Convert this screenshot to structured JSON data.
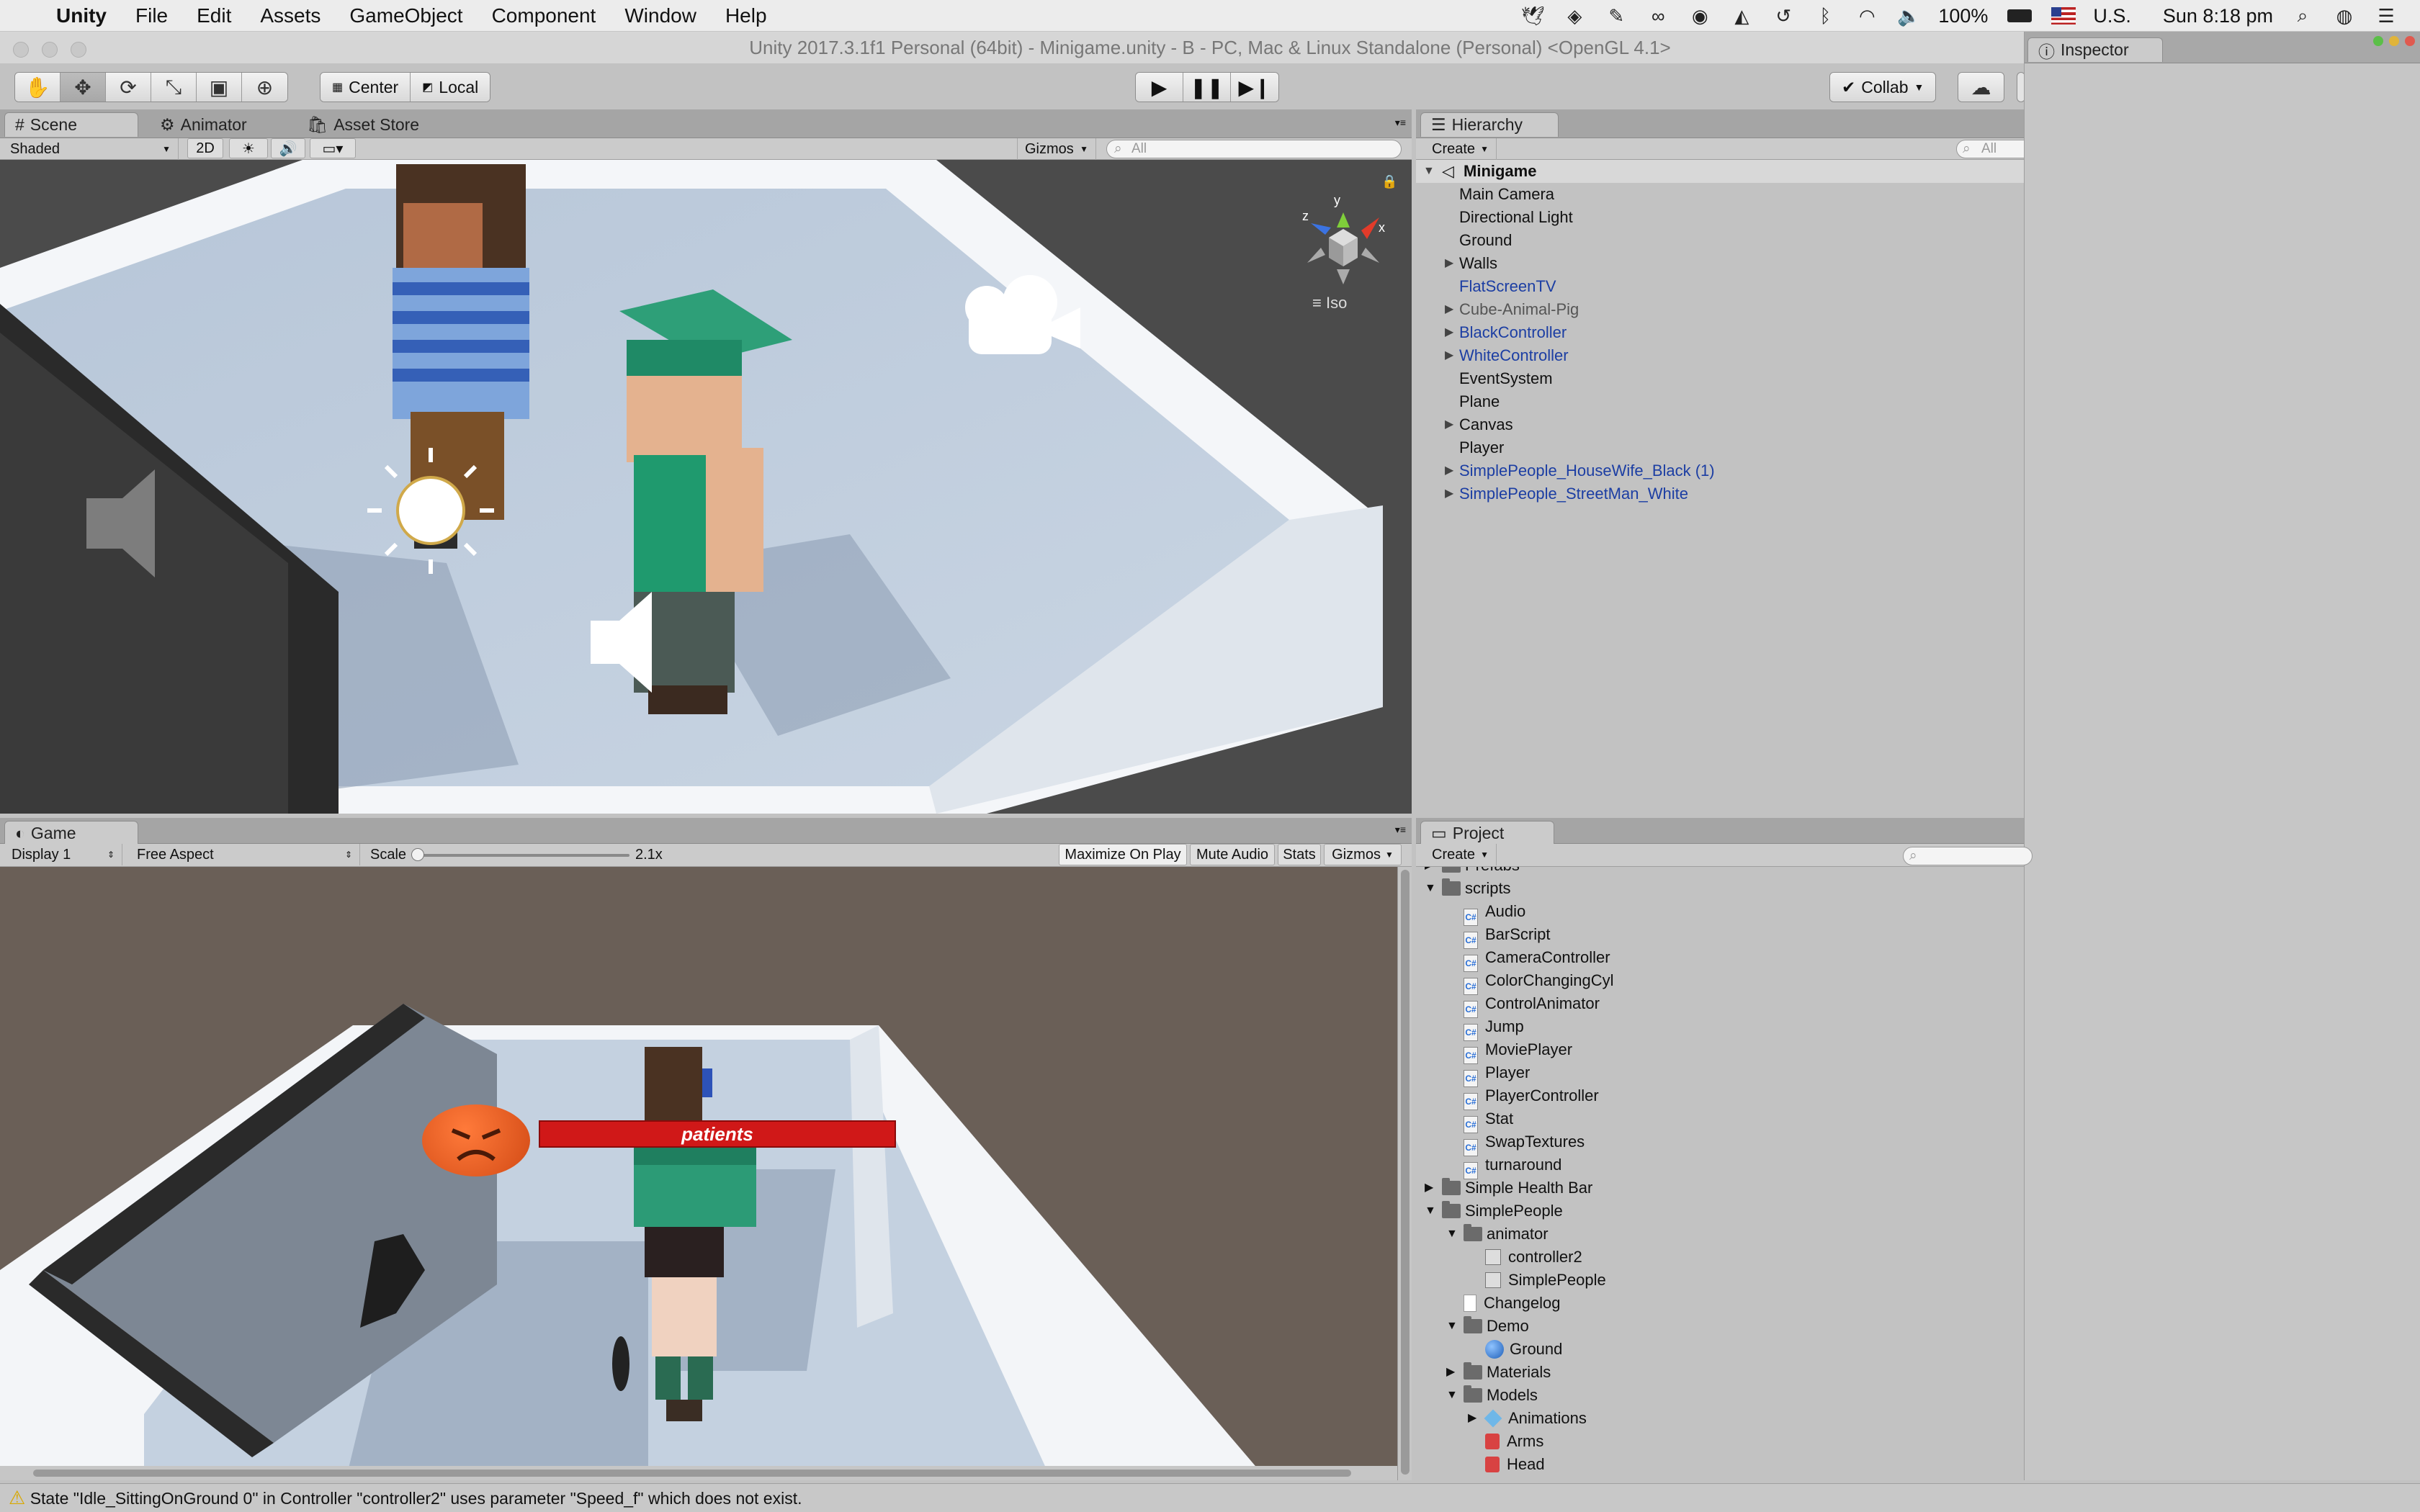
{
  "menubar": {
    "items": [
      "Unity",
      "File",
      "Edit",
      "Assets",
      "GameObject",
      "Component",
      "Window",
      "Help"
    ],
    "status": {
      "battery": "100%",
      "input_source": "U.S.",
      "clock": "Sun 8:18 pm"
    }
  },
  "window": {
    "title": "Unity 2017.3.1f1 Personal (64bit) - Minigame.unity - B - PC, Mac & Linux Standalone (Personal) <OpenGL 4.1>"
  },
  "toolbar": {
    "pivot_center": "Center",
    "pivot_local": "Local",
    "collab": "Collab"
  },
  "scene": {
    "tabs": [
      "Scene",
      "Animator",
      "Asset Store"
    ],
    "shading_mode": "Shaded",
    "mode_2d": "2D",
    "gizmos": "Gizmos",
    "search_placeholder": "All",
    "view_mode": "Iso",
    "axis_labels": {
      "x": "x",
      "y": "y",
      "z": "z"
    }
  },
  "game": {
    "tab": "Game",
    "display": "Display 1",
    "aspect": "Free Aspect",
    "scale_label": "Scale",
    "scale_value": "2.1x",
    "scale_fraction": 0.02,
    "buttons": [
      "Maximize On Play",
      "Mute Audio",
      "Stats",
      "Gizmos"
    ],
    "health_bar_label": "patients"
  },
  "hierarchy": {
    "tab": "Hierarchy",
    "create": "Create",
    "search_placeholder": "All",
    "scene_name": "Minigame",
    "items": [
      {
        "label": "Main Camera",
        "expandable": false,
        "style": "normal"
      },
      {
        "label": "Directional Light",
        "expandable": false,
        "style": "normal"
      },
      {
        "label": "Ground",
        "expandable": false,
        "style": "normal"
      },
      {
        "label": "Walls",
        "expandable": true,
        "style": "normal"
      },
      {
        "label": "FlatScreenTV",
        "expandable": false,
        "style": "prefab"
      },
      {
        "label": "Cube-Animal-Pig",
        "expandable": true,
        "style": "disabled"
      },
      {
        "label": "BlackController",
        "expandable": true,
        "style": "prefab"
      },
      {
        "label": "WhiteController",
        "expandable": true,
        "style": "prefab"
      },
      {
        "label": "EventSystem",
        "expandable": false,
        "style": "normal"
      },
      {
        "label": "Plane",
        "expandable": false,
        "style": "normal"
      },
      {
        "label": "Canvas",
        "expandable": true,
        "style": "normal"
      },
      {
        "label": "Player",
        "expandable": false,
        "style": "normal"
      },
      {
        "label": "SimplePeople_HouseWife_Black (1)",
        "expandable": true,
        "style": "prefab"
      },
      {
        "label": "SimplePeople_StreetMan_White",
        "expandable": true,
        "style": "prefab"
      }
    ]
  },
  "inspector": {
    "tab": "Inspector"
  },
  "project": {
    "tab": "Project",
    "create": "Create",
    "items": [
      {
        "label": "Prefabs",
        "indent": 0,
        "arrow": "right",
        "icon": "folder"
      },
      {
        "label": "scripts",
        "indent": 0,
        "arrow": "down",
        "icon": "folder"
      },
      {
        "label": "Audio",
        "indent": 1,
        "arrow": "",
        "icon": "script"
      },
      {
        "label": "BarScript",
        "indent": 1,
        "arrow": "",
        "icon": "script"
      },
      {
        "label": "CameraController",
        "indent": 1,
        "arrow": "",
        "icon": "script"
      },
      {
        "label": "ColorChangingCyl",
        "indent": 1,
        "arrow": "",
        "icon": "script"
      },
      {
        "label": "ControlAnimator",
        "indent": 1,
        "arrow": "",
        "icon": "script"
      },
      {
        "label": "Jump",
        "indent": 1,
        "arrow": "",
        "icon": "script"
      },
      {
        "label": "MoviePlayer",
        "indent": 1,
        "arrow": "",
        "icon": "script"
      },
      {
        "label": "Player",
        "indent": 1,
        "arrow": "",
        "icon": "script"
      },
      {
        "label": "PlayerController",
        "indent": 1,
        "arrow": "",
        "icon": "script"
      },
      {
        "label": "Stat",
        "indent": 1,
        "arrow": "",
        "icon": "script"
      },
      {
        "label": "SwapTextures",
        "indent": 1,
        "arrow": "",
        "icon": "script"
      },
      {
        "label": "turnaround",
        "indent": 1,
        "arrow": "",
        "icon": "script"
      },
      {
        "label": "Simple Health Bar",
        "indent": 0,
        "arrow": "right",
        "icon": "folder"
      },
      {
        "label": "SimplePeople",
        "indent": 0,
        "arrow": "down",
        "icon": "folder"
      },
      {
        "label": "animator",
        "indent": 1,
        "arrow": "down",
        "icon": "folder"
      },
      {
        "label": "controller2",
        "indent": 2,
        "arrow": "",
        "icon": "controller"
      },
      {
        "label": "SimplePeople",
        "indent": 2,
        "arrow": "",
        "icon": "controller"
      },
      {
        "label": "Changelog",
        "indent": 1,
        "arrow": "",
        "icon": "doc"
      },
      {
        "label": "Demo",
        "indent": 1,
        "arrow": "down",
        "icon": "folder"
      },
      {
        "label": "Ground",
        "indent": 2,
        "arrow": "",
        "icon": "sphere"
      },
      {
        "label": "Materials",
        "indent": 1,
        "arrow": "right",
        "icon": "folder"
      },
      {
        "label": "Models",
        "indent": 1,
        "arrow": "down",
        "icon": "folder"
      },
      {
        "label": "Animations",
        "indent": 2,
        "arrow": "right",
        "icon": "model"
      },
      {
        "label": "Arms",
        "indent": 2,
        "arrow": "",
        "icon": "mesh"
      },
      {
        "label": "Head",
        "indent": 2,
        "arrow": "",
        "icon": "mesh"
      }
    ]
  },
  "console": {
    "message": "State \"Idle_SittingOnGround 0\" in Controller \"controller2\" uses parameter \"Speed_f\" which does not exist."
  },
  "colors": {
    "prefab_text": "#1c3ea3",
    "health_bar": "#d01818",
    "accent_selected": "#3d7bd9"
  }
}
